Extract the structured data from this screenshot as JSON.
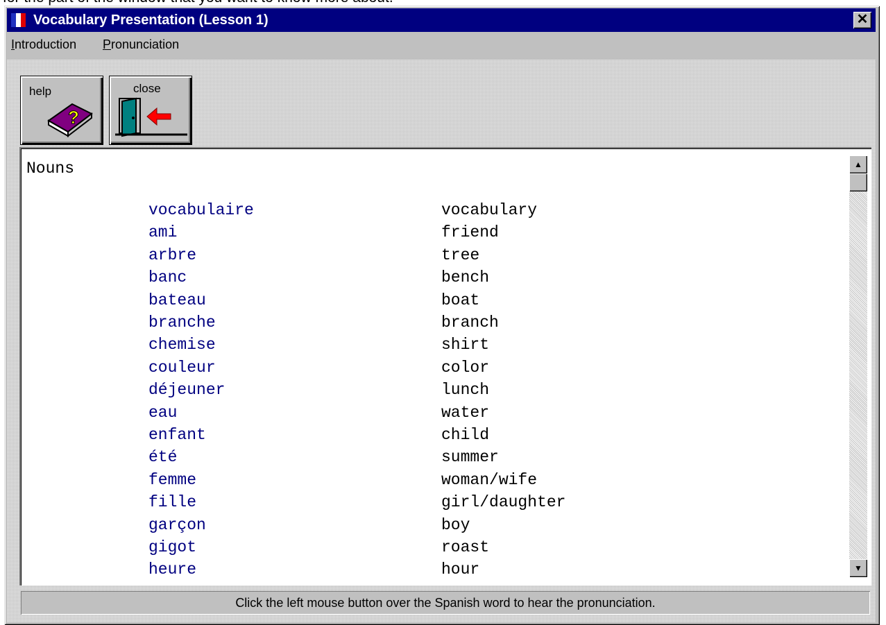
{
  "top_hint": "for the part of the window that you want to know more about.",
  "window": {
    "title": "Vocabulary Presentation (Lesson 1)",
    "close_glyph": "✕"
  },
  "menu": {
    "items": [
      {
        "label": "Introduction"
      },
      {
        "label": "Pronunciation"
      }
    ]
  },
  "toolbar": {
    "help_label": "help",
    "close_label": "close",
    "help_icon_glyph": "?"
  },
  "content": {
    "heading": "Nouns",
    "rows": [
      {
        "fr": "vocabulaire",
        "en": "vocabulary"
      },
      {
        "fr": "ami",
        "en": "friend"
      },
      {
        "fr": "arbre",
        "en": "tree"
      },
      {
        "fr": "banc",
        "en": "bench"
      },
      {
        "fr": "bateau",
        "en": "boat"
      },
      {
        "fr": "branche",
        "en": "branch"
      },
      {
        "fr": "chemise",
        "en": "shirt"
      },
      {
        "fr": "couleur",
        "en": "color"
      },
      {
        "fr": "déjeuner",
        "en": "lunch"
      },
      {
        "fr": "eau",
        "en": "water"
      },
      {
        "fr": "enfant",
        "en": "child"
      },
      {
        "fr": "été",
        "en": "summer"
      },
      {
        "fr": "femme",
        "en": "woman/wife"
      },
      {
        "fr": "fille",
        "en": "girl/daughter"
      },
      {
        "fr": "garçon",
        "en": "boy"
      },
      {
        "fr": "gigot",
        "en": "roast"
      },
      {
        "fr": "heure",
        "en": "hour"
      }
    ]
  },
  "status": {
    "text": "Click the left mouse button over the Spanish word to hear the pronunciation."
  },
  "colors": {
    "title_bar": "#000080",
    "french_word": "#000080",
    "face": "#c0c0c0"
  }
}
